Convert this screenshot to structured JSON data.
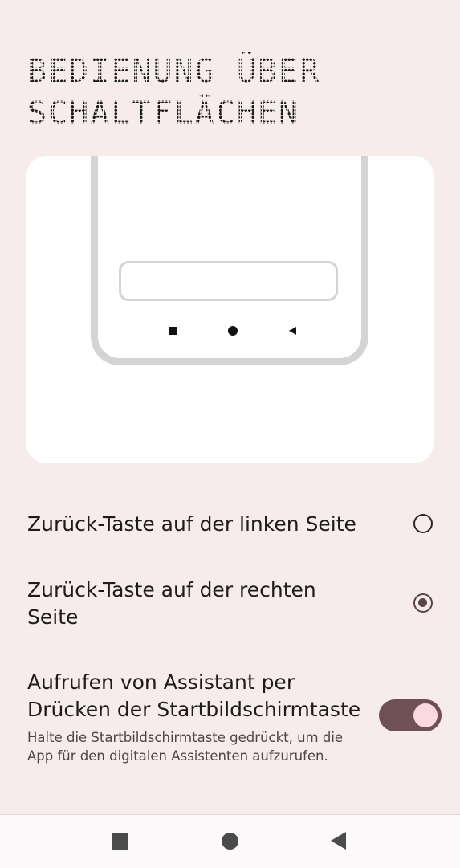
{
  "page": {
    "title_line1": "BEDIENUNG ÜBER",
    "title_line2": "SCHALTFLÄCHEN"
  },
  "options": [
    {
      "label": "Zurück-Taste auf der linken Seite",
      "selected": false
    },
    {
      "label": "Zurück-Taste auf der rechten Seite",
      "selected": true
    }
  ],
  "assistant": {
    "label": "Aufrufen von Assistant per Drücken der Startbildschirmtaste",
    "description": "Halte die Startbildschirmtaste gedrückt, um die App für den digitalen Assistenten aufzurufen.",
    "enabled": true
  },
  "colors": {
    "background": "#f6ecec",
    "accent": "#6e5055",
    "toggle_knob": "#fbd9e1"
  },
  "icons": {
    "preview_nav": [
      "square-icon",
      "circle-icon",
      "back-triangle-icon"
    ],
    "system_nav": [
      "recents-icon",
      "home-icon",
      "back-icon"
    ]
  }
}
